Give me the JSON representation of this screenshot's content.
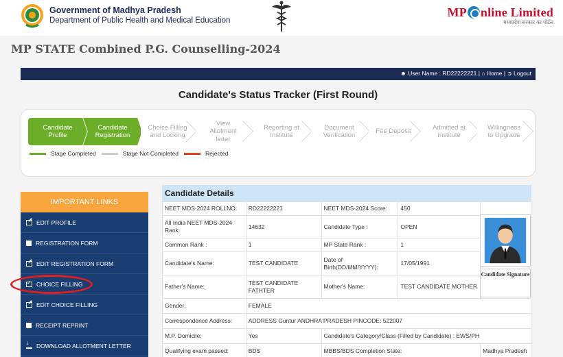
{
  "header": {
    "gov_title": "Government of Madhya Pradesh",
    "gov_subtitle": "Department of Public Health and Medical Education",
    "brand_pre": "MP",
    "brand_post": "nline Limited",
    "brand_tagline": "मध्यप्रदेश सरकार का पोर्टल"
  },
  "page_title": "MP STATE Combined P.G. Counselling-2024",
  "topbar": {
    "user_label": "User Name : RD22222221",
    "home_label": "Home",
    "logout_label": "Logout",
    "separator": "|"
  },
  "tracker": {
    "title": "Candidate's Status Tracker (First Round)",
    "stages": [
      {
        "label": "Candidate Profile",
        "status": "done"
      },
      {
        "label": "Candidate Registration",
        "status": "done"
      },
      {
        "label": "Choice Filling and Locking",
        "status": "pending"
      },
      {
        "label": "View Allotment letter",
        "status": "pending"
      },
      {
        "label": "Reporting at Institute",
        "status": "pending"
      },
      {
        "label": "Document Verification",
        "status": "pending"
      },
      {
        "label": "Fee Deposit",
        "status": "pending"
      },
      {
        "label": "Admitted at Institute",
        "status": "pending"
      },
      {
        "label": "Willingness to Upgrade",
        "status": "pending"
      }
    ],
    "legend": {
      "completed": "Stage Completed",
      "not_completed": "Stage Not Completed",
      "rejected": "Rejected"
    },
    "colors": {
      "completed": "#6cae2a",
      "not_completed": "#cccccc",
      "rejected": "#e0421f"
    }
  },
  "sidebar": {
    "heading": "IMPORTANT LINKS",
    "items": [
      {
        "label": "EDIT PROFILE",
        "icon": "edit-icon"
      },
      {
        "label": "REGISTRATION FORM",
        "icon": "form-icon"
      },
      {
        "label": "EDIT REGISTRATION FORM",
        "icon": "edit-icon"
      },
      {
        "label": "CHOICE FILLING",
        "icon": "checkbox-icon"
      },
      {
        "label": "EDIT CHOICE FILLING",
        "icon": "edit-icon"
      },
      {
        "label": "RECEIPT REPRINT",
        "icon": "receipt-icon"
      },
      {
        "label": "DOWNLOAD ALLOTMENT LETTER",
        "icon": "download-icon"
      }
    ]
  },
  "candidate": {
    "heading": "Candidate Details",
    "rollno_label": "NEET MDS-2024 ROLLNO:",
    "rollno": "RD22222221",
    "score_label": "NEET MDS-2024 Score:",
    "score": "450",
    "air_label": "All India NEET MDS-2024 Rank:",
    "air": "14632",
    "type_label": "Candidate Type :",
    "type": "OPEN",
    "common_rank_label": "Common Rank :",
    "common_rank": "1",
    "state_rank_label": "MP State Rank :",
    "state_rank": "1",
    "name_label": "Candidate's Name:",
    "name": "TEST CANDIDATE",
    "dob_label": "Date of Birth(DD/MM/YYYY):",
    "dob": "17/05/1991",
    "father_label": "Father's Name:",
    "father": "TEST CANDIDATE FATHTER",
    "mother_label": "Mother's Name:",
    "mother": "TEST CANDIDATE MOTHER",
    "gender_label": "Gender:",
    "gender": "FEMALE",
    "address_label": "Correspondence Address:",
    "address": "ADDRESS Guntur ANDHRA PRADESH PINCODE: 522007",
    "domicile_label": "M.P. Domicile:",
    "domicile": "Yes",
    "category_text": "Candidate's Category/Class (Filled by Candidate) : EWS/PH",
    "exam_label": "Qualifying exam passed:",
    "exam": "BDS",
    "completion_label": "MBBS/BDS Completion State:",
    "completion_state": "Madhya Pradesh",
    "signature_label": "Candidate Signature"
  }
}
